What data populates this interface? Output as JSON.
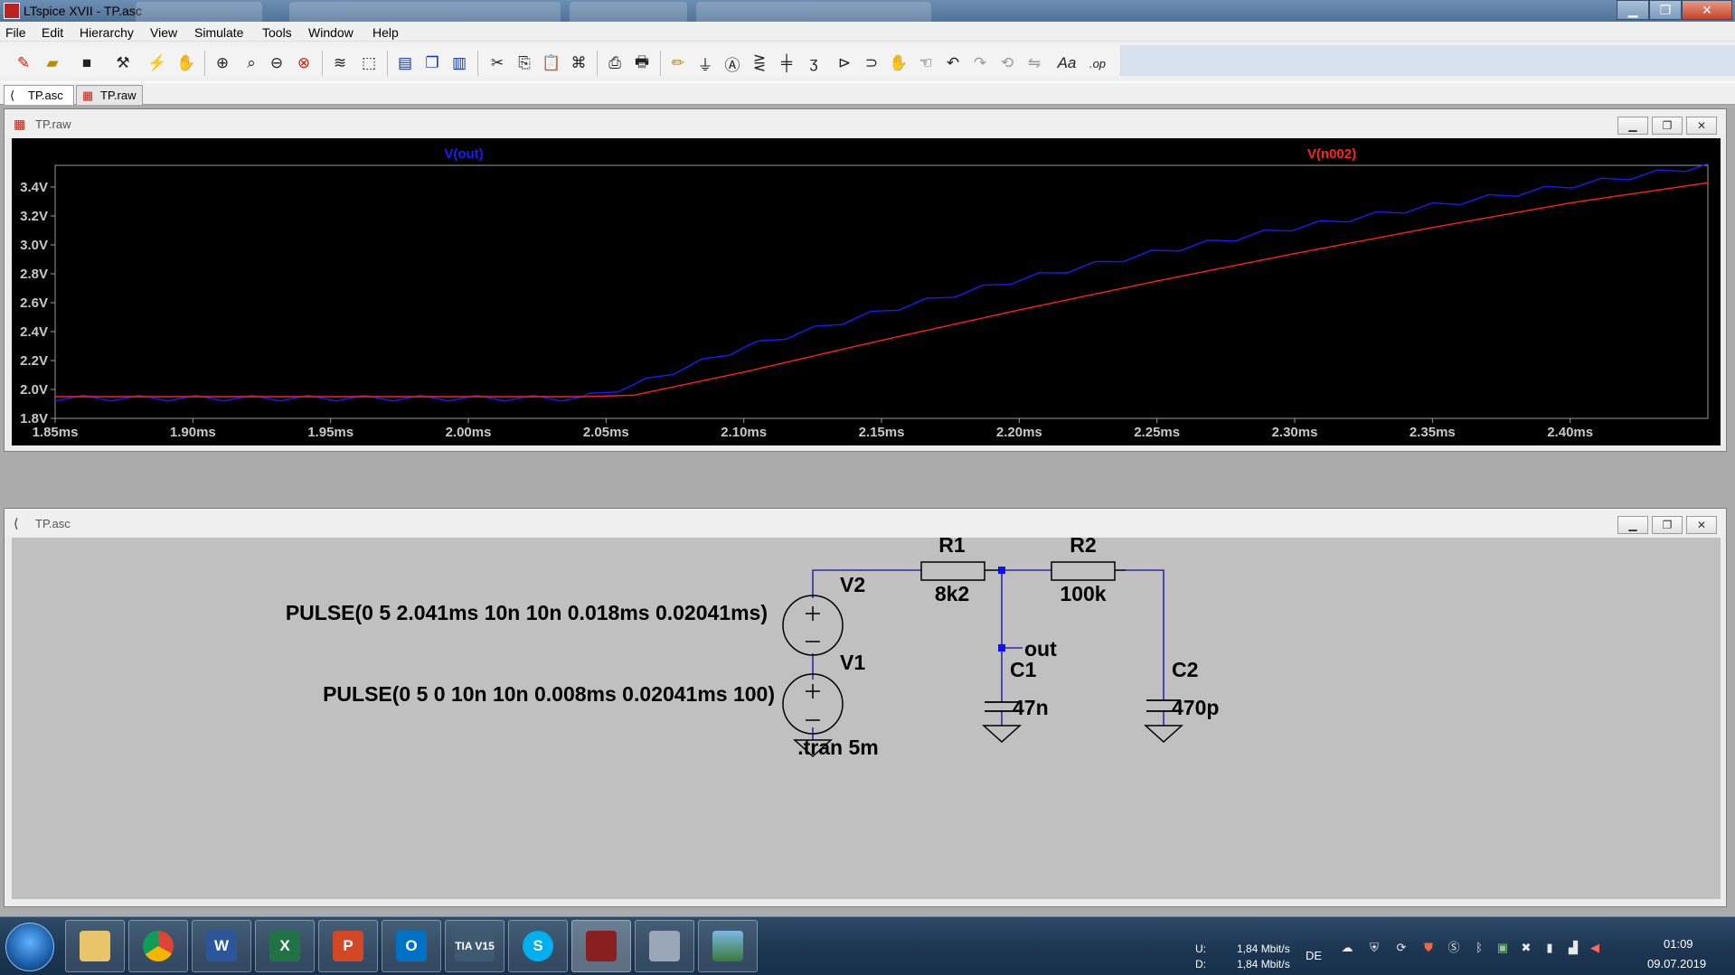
{
  "window": {
    "title": "LTspice XVII - TP.asc",
    "minimize_glyph": "▁",
    "maximize_glyph": "❐",
    "close_glyph": "✕"
  },
  "menu": [
    "File",
    "Edit",
    "Hierarchy",
    "View",
    "Simulate",
    "Tools",
    "Window",
    "Help"
  ],
  "toolbar": {
    "icons": [
      "new-schematic-icon",
      "open-icon",
      "save-icon",
      "control-panel-icon",
      "run-icon",
      "halt-icon",
      "zoom-in-icon",
      "zoom-pan-icon",
      "zoom-out-icon",
      "zoom-fit-icon",
      "autorange-icon",
      "zoom-rect-icon",
      "tile-horizontal-icon",
      "cascade-icon",
      "tile-vertical-icon",
      "cut-icon",
      "copy-icon",
      "paste-icon",
      "find-icon",
      "print-preview-icon",
      "print-icon",
      "draw-wire-icon",
      "ground-icon",
      "label-net-icon",
      "resistor-icon",
      "capacitor-icon",
      "inductor-icon",
      "diode-icon",
      "component-icon",
      "move-icon",
      "drag-icon",
      "undo-icon",
      "redo-icon",
      "rotate-icon",
      "mirror-icon",
      "text-icon",
      "spice-directive-icon"
    ],
    "spice_directive_label": ".op",
    "text_label": "Aa"
  },
  "tabs": [
    {
      "label": "TP.asc",
      "icon": "schematic-icon",
      "active": true
    },
    {
      "label": "TP.raw",
      "icon": "waveform-icon",
      "active": false
    }
  ],
  "waveform_window": {
    "title": "TP.raw",
    "chart_data": {
      "type": "line",
      "x_unit": "ms",
      "xlim": [
        1.85,
        2.45
      ],
      "ylim": [
        1.8,
        3.55
      ],
      "x_ticks": [
        "1.85ms",
        "1.90ms",
        "1.95ms",
        "2.00ms",
        "2.05ms",
        "2.10ms",
        "2.15ms",
        "2.20ms",
        "2.25ms",
        "2.30ms",
        "2.35ms",
        "2.40ms"
      ],
      "y_ticks": [
        "1.8V",
        "2.0V",
        "2.2V",
        "2.4V",
        "2.6V",
        "2.8V",
        "3.0V",
        "3.2V",
        "3.4V"
      ],
      "x_tick_values": [
        1.85,
        1.9,
        1.95,
        2.0,
        2.05,
        2.1,
        2.15,
        2.2,
        2.25,
        2.3,
        2.35,
        2.4
      ],
      "y_tick_values": [
        1.8,
        2.0,
        2.2,
        2.4,
        2.6,
        2.8,
        3.0,
        3.2,
        3.4
      ],
      "grid": false,
      "series": [
        {
          "name": "V(out)",
          "color": "#1a1aff",
          "x": [
            1.85,
            1.95,
            2.041,
            2.06,
            2.1,
            2.15,
            2.2,
            2.25,
            2.3,
            2.35,
            2.4,
            2.45
          ],
          "y": [
            1.94,
            1.94,
            1.94,
            2.03,
            2.29,
            2.54,
            2.76,
            2.95,
            3.12,
            3.27,
            3.41,
            3.55
          ],
          "ripple": 0.04,
          "ripple_period_ms": 0.02041
        },
        {
          "name": "V(n002)",
          "color": "#ff2020",
          "x": [
            1.85,
            1.95,
            2.041,
            2.06,
            2.1,
            2.15,
            2.2,
            2.25,
            2.3,
            2.35,
            2.4,
            2.45
          ],
          "y": [
            1.95,
            1.95,
            1.95,
            1.96,
            2.12,
            2.34,
            2.55,
            2.75,
            2.94,
            3.12,
            3.29,
            3.43
          ]
        }
      ]
    }
  },
  "schematic_window": {
    "title": "TP.asc",
    "components": {
      "V2": {
        "name": "V2",
        "value": "PULSE(0 5 2.041ms 10n 10n 0.018ms 0.02041ms)"
      },
      "V1": {
        "name": "V1",
        "value": "PULSE(0 5 0 10n 10n 0.008ms 0.02041ms 100)"
      },
      "R1": {
        "name": "R1",
        "value": "8k2"
      },
      "R2": {
        "name": "R2",
        "value": "100k"
      },
      "C1": {
        "name": "C1",
        "value": "47n"
      },
      "C2": {
        "name": "C2",
        "value": "470p"
      }
    },
    "net_label": "out",
    "directive": ".tran 5m"
  },
  "taskbar": {
    "apps": [
      {
        "name": "explorer",
        "label": ""
      },
      {
        "name": "chrome",
        "label": ""
      },
      {
        "name": "word",
        "label": "W"
      },
      {
        "name": "excel",
        "label": "X"
      },
      {
        "name": "powerpoint",
        "label": "P"
      },
      {
        "name": "outlook",
        "label": "O"
      },
      {
        "name": "tia-portal",
        "label": "TIA V15"
      },
      {
        "name": "skype",
        "label": "S"
      },
      {
        "name": "ltspice",
        "label": ""
      },
      {
        "name": "calculator",
        "label": ""
      },
      {
        "name": "photos",
        "label": ""
      }
    ],
    "network": {
      "up_label": "U:",
      "down_label": "D:",
      "up": "1,84 Mbit/s",
      "down": "1,84 Mbit/s"
    },
    "language": "DE",
    "time": "01:09",
    "date": "09.07.2019"
  }
}
